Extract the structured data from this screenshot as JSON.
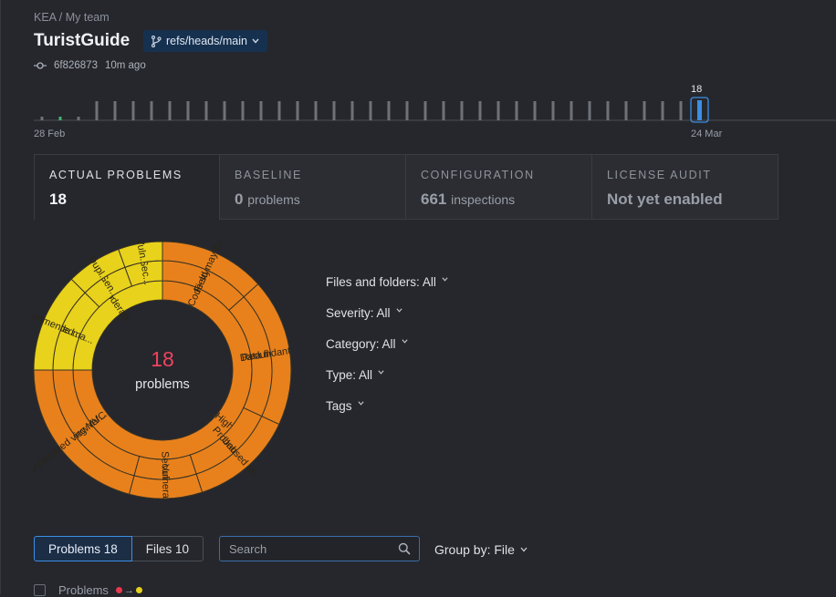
{
  "breadcrumb": "KEA / My team",
  "project": {
    "title": "TuristGuide",
    "branch": "refs/heads/main"
  },
  "commit": {
    "hash": "6f826873",
    "time": "10m ago"
  },
  "timeline": {
    "start_label": "28 Feb",
    "end_label": "24 Mar",
    "selected_value": "18",
    "colors": {
      "bar": "#6e7178",
      "green": "#49b36a",
      "selected": "#3b8ee6"
    }
  },
  "tabs": [
    {
      "label": "ACTUAL PROBLEMS",
      "value": "18",
      "sub": ""
    },
    {
      "label": "BASELINE",
      "value": "0",
      "sub": "problems"
    },
    {
      "label": "CONFIGURATION",
      "value": "661",
      "sub": "inspections"
    },
    {
      "label": "LICENSE AUDIT",
      "value": "Not yet enabled",
      "sub": ""
    }
  ],
  "sunburst": {
    "center_value": "18",
    "center_label": "problems",
    "colors": {
      "high": "#e8811c",
      "moderate": "#e8d21b",
      "center_value": "#f0425e"
    },
    "inner": [
      {
        "label": "Moderate",
        "severity": "moderate"
      },
      {
        "label": "High",
        "severity": "high"
      }
    ],
    "middle": [
      {
        "label": "Code ma...",
        "severity": "moderate"
      },
      {
        "label": "Gen...",
        "severity": "moderate"
      },
      {
        "label": "Sec...",
        "severity": "moderate"
      },
      {
        "label": "Code style ...",
        "severity": "high"
      },
      {
        "label": "Data flow",
        "severity": "high"
      },
      {
        "label": "Probabl...",
        "severity": "high"
      },
      {
        "label": "Security",
        "severity": "high"
      },
      {
        "label": "Spring MVC",
        "severity": "high"
      }
    ],
    "outer": [
      {
        "label": "Commented...",
        "severity": "moderate"
      },
      {
        "label": "Dupl...",
        "severity": "moderate"
      },
      {
        "label": "Vuln...",
        "severity": "moderate"
      },
      {
        "label": "Field may be ...",
        "severity": "high"
      },
      {
        "label": "Redundant loca...",
        "severity": "high"
      },
      {
        "label": "Unused as...",
        "severity": "high"
      },
      {
        "label": "Vulnerabl...",
        "severity": "high"
      },
      {
        "label": "Unresolved view ref...",
        "severity": "high"
      }
    ]
  },
  "filters": [
    {
      "label": "Files and folders:",
      "value": "All"
    },
    {
      "label": "Severity:",
      "value": "All"
    },
    {
      "label": "Category:",
      "value": "All"
    },
    {
      "label": "Type:",
      "value": "All"
    },
    {
      "label": "Tags",
      "value": ""
    }
  ],
  "view_toggle": {
    "problems": "Problems 18",
    "files": "Files 10"
  },
  "search": {
    "placeholder": "Search"
  },
  "group_by": "Group by: File",
  "list_header": {
    "label": "Problems",
    "dot_from": "#e8384f",
    "dot_to": "#e8d21b"
  }
}
